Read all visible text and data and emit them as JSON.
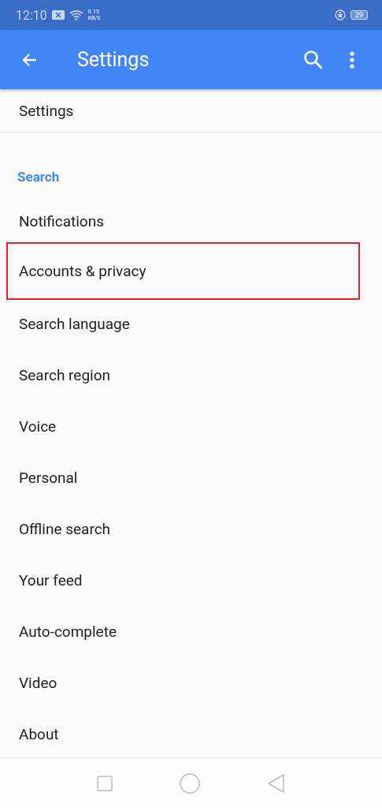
{
  "status_bar": {
    "time": "12:10",
    "speed_value": "0.15",
    "speed_unit": "KB/S",
    "battery": "29"
  },
  "app_bar": {
    "title": "Settings"
  },
  "top_item": "Settings",
  "section": {
    "title": "Search",
    "items": [
      {
        "label": "Notifications",
        "highlighted": false
      },
      {
        "label": "Accounts & privacy",
        "highlighted": true
      },
      {
        "label": "Search language",
        "highlighted": false
      },
      {
        "label": "Search region",
        "highlighted": false
      },
      {
        "label": "Voice",
        "highlighted": false
      },
      {
        "label": "Personal",
        "highlighted": false
      },
      {
        "label": "Offline search",
        "highlighted": false
      },
      {
        "label": "Your feed",
        "highlighted": false
      },
      {
        "label": "Auto-complete",
        "highlighted": false
      },
      {
        "label": "Video",
        "highlighted": false
      },
      {
        "label": "About",
        "highlighted": false
      }
    ]
  }
}
